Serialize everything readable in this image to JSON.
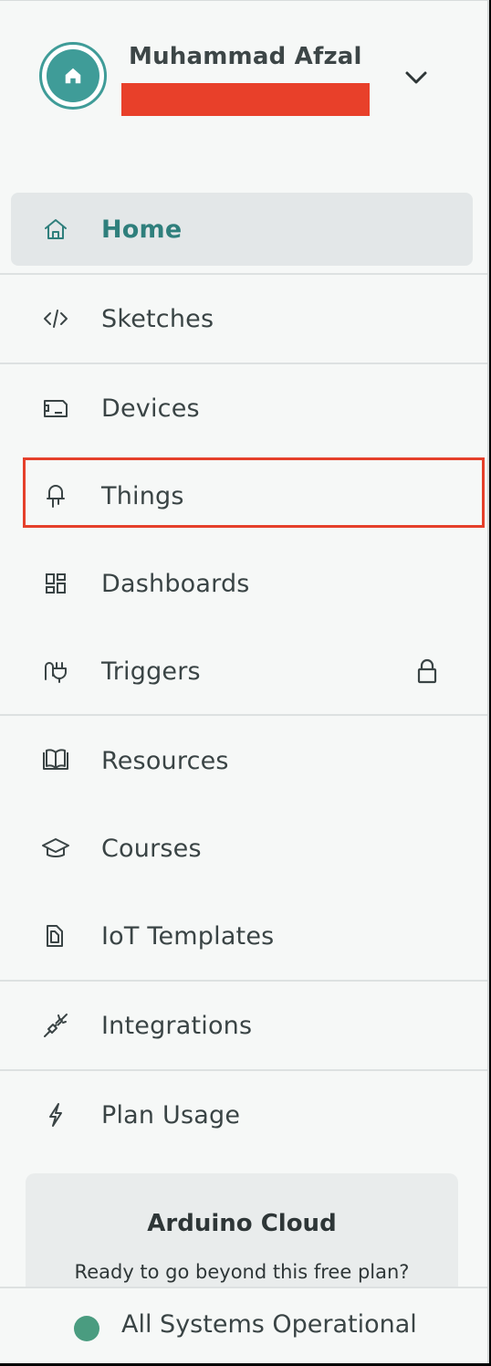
{
  "user": {
    "name": "Muhammad Afzal",
    "avatar_icon": "home-icon",
    "menu_icon": "chevron-down-icon"
  },
  "nav": {
    "items": [
      {
        "label": "Home",
        "icon": "home-icon",
        "active": true
      },
      {
        "label": "Sketches",
        "icon": "code-icon"
      },
      {
        "label": "Devices",
        "icon": "device-icon"
      },
      {
        "label": "Things",
        "icon": "thing-icon",
        "highlighted": true
      },
      {
        "label": "Dashboards",
        "icon": "dashboard-icon"
      },
      {
        "label": "Triggers",
        "icon": "trigger-icon",
        "locked": true,
        "lock_icon": "lock-icon"
      },
      {
        "label": "Resources",
        "icon": "book-icon"
      },
      {
        "label": "Courses",
        "icon": "graduation-cap-icon"
      },
      {
        "label": "IoT Templates",
        "icon": "templates-icon"
      },
      {
        "label": "Integrations",
        "icon": "plug-icon"
      },
      {
        "label": "Plan Usage",
        "icon": "lightning-icon"
      }
    ]
  },
  "upgrade_card": {
    "title": "Arduino Cloud",
    "text": "Ready to go beyond this free plan?"
  },
  "status": {
    "text": "All Systems Operational",
    "color": "#4a9c80"
  },
  "colors": {
    "accent": "#2f7f7c",
    "avatar": "#3f9c98",
    "highlight": "#e5402b",
    "redaction": "#e8402a"
  }
}
